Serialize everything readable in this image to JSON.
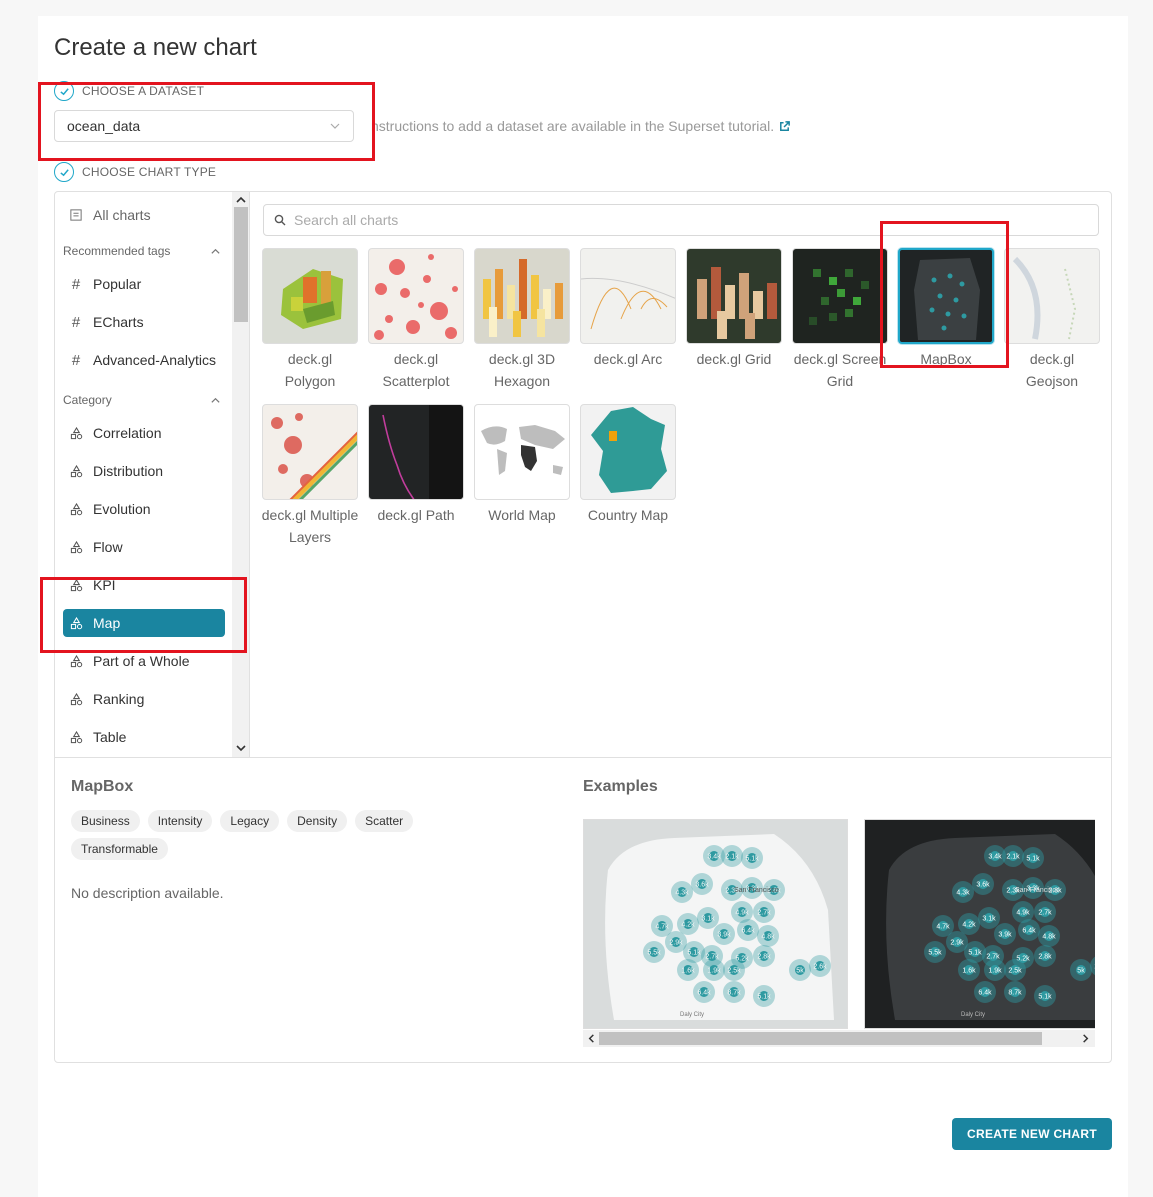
{
  "page": {
    "title": "Create a new chart"
  },
  "dataset_step": {
    "label": "CHOOSE A DATASET",
    "selected": "ocean_data",
    "hint": "nstructions to add a dataset are available in the Superset tutorial."
  },
  "chart_type_step": {
    "label": "CHOOSE CHART TYPE"
  },
  "sidebar": {
    "all_charts": "All charts",
    "recommended_header": "Recommended tags",
    "recommended": [
      {
        "label": "Popular"
      },
      {
        "label": "ECharts"
      },
      {
        "label": "Advanced-Analytics"
      }
    ],
    "category_header": "Category",
    "categories": [
      {
        "label": "Correlation"
      },
      {
        "label": "Distribution"
      },
      {
        "label": "Evolution"
      },
      {
        "label": "Flow"
      },
      {
        "label": "KPI"
      },
      {
        "label": "Map",
        "active": true
      },
      {
        "label": "Part of a Whole"
      },
      {
        "label": "Ranking"
      },
      {
        "label": "Table"
      }
    ]
  },
  "search": {
    "placeholder": "Search all charts"
  },
  "charts": [
    {
      "label": "deck.gl Polygon"
    },
    {
      "label": "deck.gl Scatterplot"
    },
    {
      "label": "deck.gl 3D Hexagon"
    },
    {
      "label": "deck.gl Arc"
    },
    {
      "label": "deck.gl Grid"
    },
    {
      "label": "deck.gl Screen Grid"
    },
    {
      "label": "MapBox",
      "selected": true
    },
    {
      "label": "deck.gl Geojson"
    },
    {
      "label": "deck.gl Multiple Layers"
    },
    {
      "label": "deck.gl Path"
    },
    {
      "label": "World Map"
    },
    {
      "label": "Country Map"
    }
  ],
  "detail": {
    "title": "MapBox",
    "tags": [
      "Business",
      "Intensity",
      "Legacy",
      "Density",
      "Scatter",
      "Transformable"
    ],
    "description": "No description available.",
    "examples_title": "Examples",
    "example_labels": {
      "clusters": [
        "3.4k",
        "2.1k",
        "5.1k",
        "3.6k",
        "4.3k",
        "2.3k",
        "3.3k",
        "2.8k",
        "4.9k",
        "2.7k",
        "4.7k",
        "4.2k",
        "3.1k",
        "3.9k",
        "6.4k",
        "4.8k",
        "2.9k",
        "5.5k",
        "5.1k",
        "2.7k",
        "5.2k",
        "2.8k",
        "2.5k",
        "5k",
        "2.6k",
        "1.9k",
        "6.4k",
        "8.7k",
        "5.1k",
        "1.6k"
      ],
      "city": "San Francisco",
      "south": "Daly City"
    }
  },
  "actions": {
    "create": "CREATE NEW CHART"
  },
  "colors": {
    "accent": "#1a85a0",
    "selected_border": "#20a7c9",
    "highlight": "#e3141f"
  }
}
